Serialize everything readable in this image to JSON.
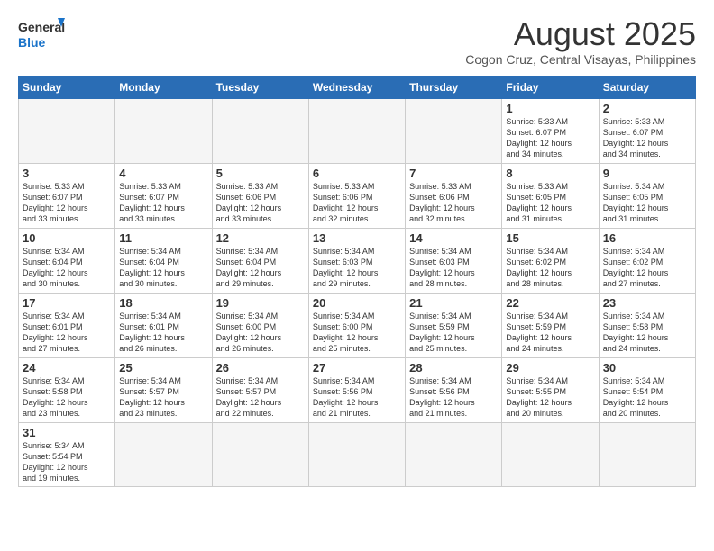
{
  "logo": {
    "text_general": "General",
    "text_blue": "Blue"
  },
  "header": {
    "month_title": "August 2025",
    "location": "Cogon Cruz, Central Visayas, Philippines"
  },
  "weekdays": [
    "Sunday",
    "Monday",
    "Tuesday",
    "Wednesday",
    "Thursday",
    "Friday",
    "Saturday"
  ],
  "weeks": [
    [
      {
        "num": "",
        "info": ""
      },
      {
        "num": "",
        "info": ""
      },
      {
        "num": "",
        "info": ""
      },
      {
        "num": "",
        "info": ""
      },
      {
        "num": "",
        "info": ""
      },
      {
        "num": "1",
        "info": "Sunrise: 5:33 AM\nSunset: 6:07 PM\nDaylight: 12 hours\nand 34 minutes."
      },
      {
        "num": "2",
        "info": "Sunrise: 5:33 AM\nSunset: 6:07 PM\nDaylight: 12 hours\nand 34 minutes."
      }
    ],
    [
      {
        "num": "3",
        "info": "Sunrise: 5:33 AM\nSunset: 6:07 PM\nDaylight: 12 hours\nand 33 minutes."
      },
      {
        "num": "4",
        "info": "Sunrise: 5:33 AM\nSunset: 6:07 PM\nDaylight: 12 hours\nand 33 minutes."
      },
      {
        "num": "5",
        "info": "Sunrise: 5:33 AM\nSunset: 6:06 PM\nDaylight: 12 hours\nand 33 minutes."
      },
      {
        "num": "6",
        "info": "Sunrise: 5:33 AM\nSunset: 6:06 PM\nDaylight: 12 hours\nand 32 minutes."
      },
      {
        "num": "7",
        "info": "Sunrise: 5:33 AM\nSunset: 6:06 PM\nDaylight: 12 hours\nand 32 minutes."
      },
      {
        "num": "8",
        "info": "Sunrise: 5:33 AM\nSunset: 6:05 PM\nDaylight: 12 hours\nand 31 minutes."
      },
      {
        "num": "9",
        "info": "Sunrise: 5:34 AM\nSunset: 6:05 PM\nDaylight: 12 hours\nand 31 minutes."
      }
    ],
    [
      {
        "num": "10",
        "info": "Sunrise: 5:34 AM\nSunset: 6:04 PM\nDaylight: 12 hours\nand 30 minutes."
      },
      {
        "num": "11",
        "info": "Sunrise: 5:34 AM\nSunset: 6:04 PM\nDaylight: 12 hours\nand 30 minutes."
      },
      {
        "num": "12",
        "info": "Sunrise: 5:34 AM\nSunset: 6:04 PM\nDaylight: 12 hours\nand 29 minutes."
      },
      {
        "num": "13",
        "info": "Sunrise: 5:34 AM\nSunset: 6:03 PM\nDaylight: 12 hours\nand 29 minutes."
      },
      {
        "num": "14",
        "info": "Sunrise: 5:34 AM\nSunset: 6:03 PM\nDaylight: 12 hours\nand 28 minutes."
      },
      {
        "num": "15",
        "info": "Sunrise: 5:34 AM\nSunset: 6:02 PM\nDaylight: 12 hours\nand 28 minutes."
      },
      {
        "num": "16",
        "info": "Sunrise: 5:34 AM\nSunset: 6:02 PM\nDaylight: 12 hours\nand 27 minutes."
      }
    ],
    [
      {
        "num": "17",
        "info": "Sunrise: 5:34 AM\nSunset: 6:01 PM\nDaylight: 12 hours\nand 27 minutes."
      },
      {
        "num": "18",
        "info": "Sunrise: 5:34 AM\nSunset: 6:01 PM\nDaylight: 12 hours\nand 26 minutes."
      },
      {
        "num": "19",
        "info": "Sunrise: 5:34 AM\nSunset: 6:00 PM\nDaylight: 12 hours\nand 26 minutes."
      },
      {
        "num": "20",
        "info": "Sunrise: 5:34 AM\nSunset: 6:00 PM\nDaylight: 12 hours\nand 25 minutes."
      },
      {
        "num": "21",
        "info": "Sunrise: 5:34 AM\nSunset: 5:59 PM\nDaylight: 12 hours\nand 25 minutes."
      },
      {
        "num": "22",
        "info": "Sunrise: 5:34 AM\nSunset: 5:59 PM\nDaylight: 12 hours\nand 24 minutes."
      },
      {
        "num": "23",
        "info": "Sunrise: 5:34 AM\nSunset: 5:58 PM\nDaylight: 12 hours\nand 24 minutes."
      }
    ],
    [
      {
        "num": "24",
        "info": "Sunrise: 5:34 AM\nSunset: 5:58 PM\nDaylight: 12 hours\nand 23 minutes."
      },
      {
        "num": "25",
        "info": "Sunrise: 5:34 AM\nSunset: 5:57 PM\nDaylight: 12 hours\nand 23 minutes."
      },
      {
        "num": "26",
        "info": "Sunrise: 5:34 AM\nSunset: 5:57 PM\nDaylight: 12 hours\nand 22 minutes."
      },
      {
        "num": "27",
        "info": "Sunrise: 5:34 AM\nSunset: 5:56 PM\nDaylight: 12 hours\nand 21 minutes."
      },
      {
        "num": "28",
        "info": "Sunrise: 5:34 AM\nSunset: 5:56 PM\nDaylight: 12 hours\nand 21 minutes."
      },
      {
        "num": "29",
        "info": "Sunrise: 5:34 AM\nSunset: 5:55 PM\nDaylight: 12 hours\nand 20 minutes."
      },
      {
        "num": "30",
        "info": "Sunrise: 5:34 AM\nSunset: 5:54 PM\nDaylight: 12 hours\nand 20 minutes."
      }
    ],
    [
      {
        "num": "31",
        "info": "Sunrise: 5:34 AM\nSunset: 5:54 PM\nDaylight: 12 hours\nand 19 minutes."
      },
      {
        "num": "",
        "info": ""
      },
      {
        "num": "",
        "info": ""
      },
      {
        "num": "",
        "info": ""
      },
      {
        "num": "",
        "info": ""
      },
      {
        "num": "",
        "info": ""
      },
      {
        "num": "",
        "info": ""
      }
    ]
  ]
}
